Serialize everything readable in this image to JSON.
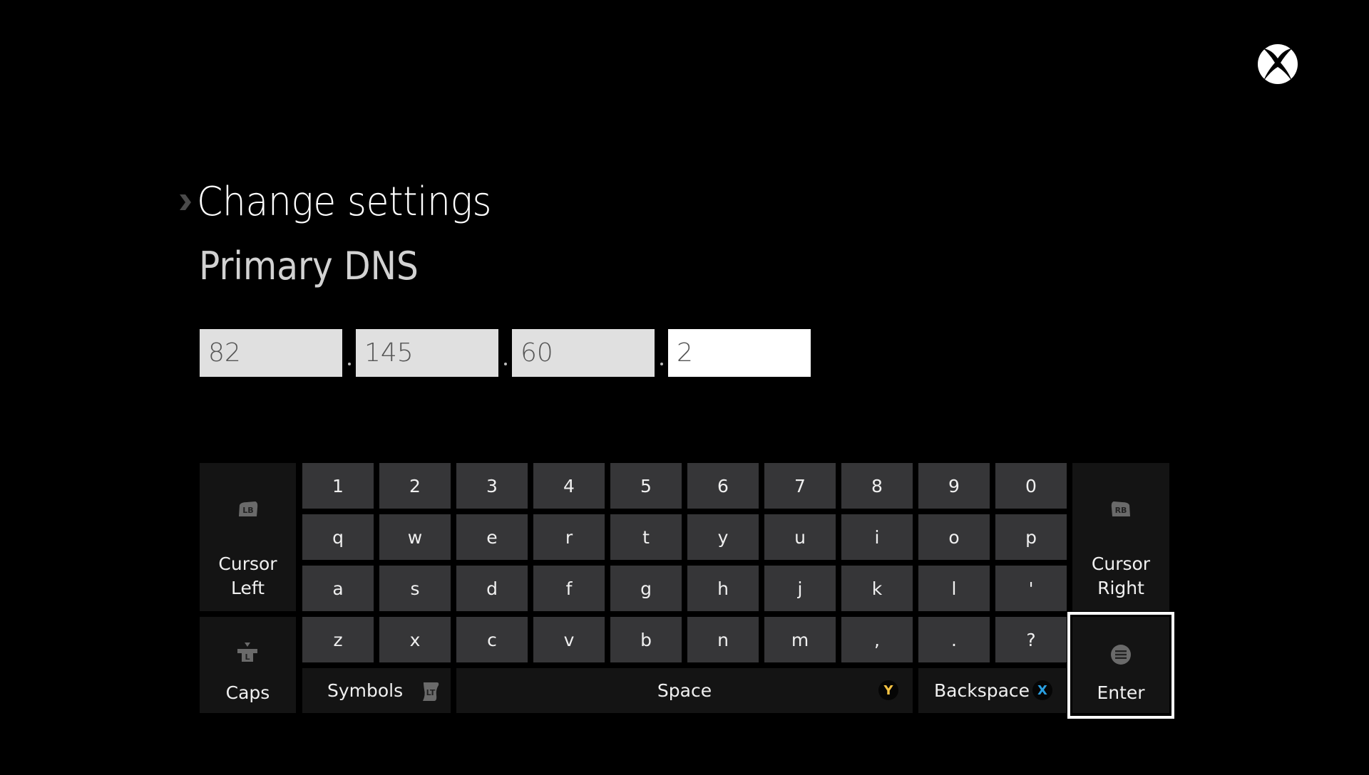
{
  "header": {
    "logo_icon": "xbox-logo-icon",
    "breadcrumb_icon": "chevron-right-icon",
    "title": "Change settings",
    "subtitle": "Primary DNS"
  },
  "ip_fields": [
    {
      "value": "82",
      "focused": false
    },
    {
      "value": "145",
      "focused": false
    },
    {
      "value": "60",
      "focused": false
    },
    {
      "value": "2",
      "focused": true
    }
  ],
  "ip_separator": ".",
  "keyboard": {
    "rows": [
      [
        "1",
        "2",
        "3",
        "4",
        "5",
        "6",
        "7",
        "8",
        "9",
        "0"
      ],
      [
        "q",
        "w",
        "e",
        "r",
        "t",
        "y",
        "u",
        "i",
        "o",
        "p"
      ],
      [
        "a",
        "s",
        "d",
        "f",
        "g",
        "h",
        "j",
        "k",
        "l",
        "'"
      ],
      [
        "z",
        "x",
        "c",
        "v",
        "b",
        "n",
        "m",
        ",",
        ".",
        "?"
      ]
    ],
    "cursor_left": {
      "line1": "Cursor",
      "line2": "Left",
      "hint": "LB"
    },
    "cursor_right": {
      "line1": "Cursor",
      "line2": "Right",
      "hint": "RB"
    },
    "caps": {
      "label": "Caps",
      "hint": "L"
    },
    "symbols": {
      "label": "Symbols",
      "hint": "LT"
    },
    "space": {
      "label": "Space",
      "hint": "Y",
      "hint_color": "#f5c242"
    },
    "backspace": {
      "label": "Backspace",
      "hint": "X",
      "hint_color": "#2a9fe0"
    },
    "enter": {
      "label": "Enter",
      "hint_icon": "menu-button-icon",
      "focused": true
    }
  }
}
